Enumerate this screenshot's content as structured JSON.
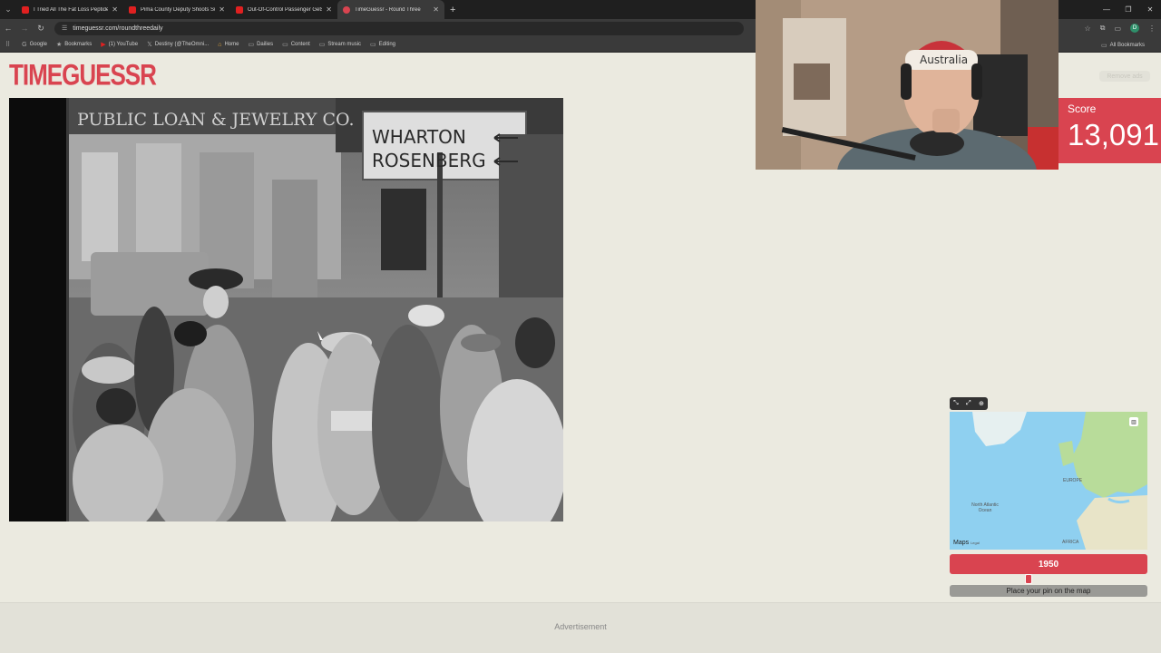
{
  "browser": {
    "tabs": [
      {
        "title": "I Tried All The Fat Loss Peptide",
        "favicon_color": "#e02020",
        "active": false
      },
      {
        "title": "Pima County Deputy Shoots Su",
        "favicon_color": "#e02020",
        "active": false
      },
      {
        "title": "Out-Of-Control Passenger Gets",
        "favicon_color": "#e02020",
        "active": false
      },
      {
        "title": "TimeGuessr - Round Three",
        "favicon_color": "#d94450",
        "active": true
      }
    ],
    "url": "timeguessr.com/roundthreedaily",
    "profile_initial": "D",
    "bookmarks": [
      {
        "icon": "google-icon",
        "label": "Google"
      },
      {
        "icon": "star-icon",
        "label": "Bookmarks"
      },
      {
        "icon": "youtube-icon",
        "label": "(1) YouTube"
      },
      {
        "icon": "x-icon",
        "label": "Destiny (@TheOmni..."
      },
      {
        "icon": "home-icon",
        "label": "Home"
      },
      {
        "icon": "folder-icon",
        "label": "Dailies"
      },
      {
        "icon": "folder-icon",
        "label": "Content"
      },
      {
        "icon": "folder-icon",
        "label": "Stream music"
      },
      {
        "icon": "folder-icon",
        "label": "Editing"
      }
    ],
    "all_bookmarks": "All Bookmarks"
  },
  "game": {
    "logo": "TIMEGUESSR",
    "remove_ads": "Remove ads",
    "score_label": "Score",
    "score_value": "13,091",
    "photo_signs": {
      "store": "PUBLIC LOAN & JEWELRY CO.",
      "street_sign_line1": "WHARTON",
      "street_sign_line2": "ROSENBERG"
    },
    "webcam_hat_text": "Australia",
    "map": {
      "labels": [
        "EUROPE",
        "North Atlantic Ocean",
        "AFRICA"
      ],
      "maps_brand": "Maps",
      "legal": "Legal"
    },
    "year_value": "1950",
    "year_slider_fraction": 0.4,
    "pin_button": "Place your pin on the map",
    "advertisement": "Advertisement"
  },
  "colors": {
    "brand": "#d94450",
    "page_bg": "#ebeae0"
  }
}
